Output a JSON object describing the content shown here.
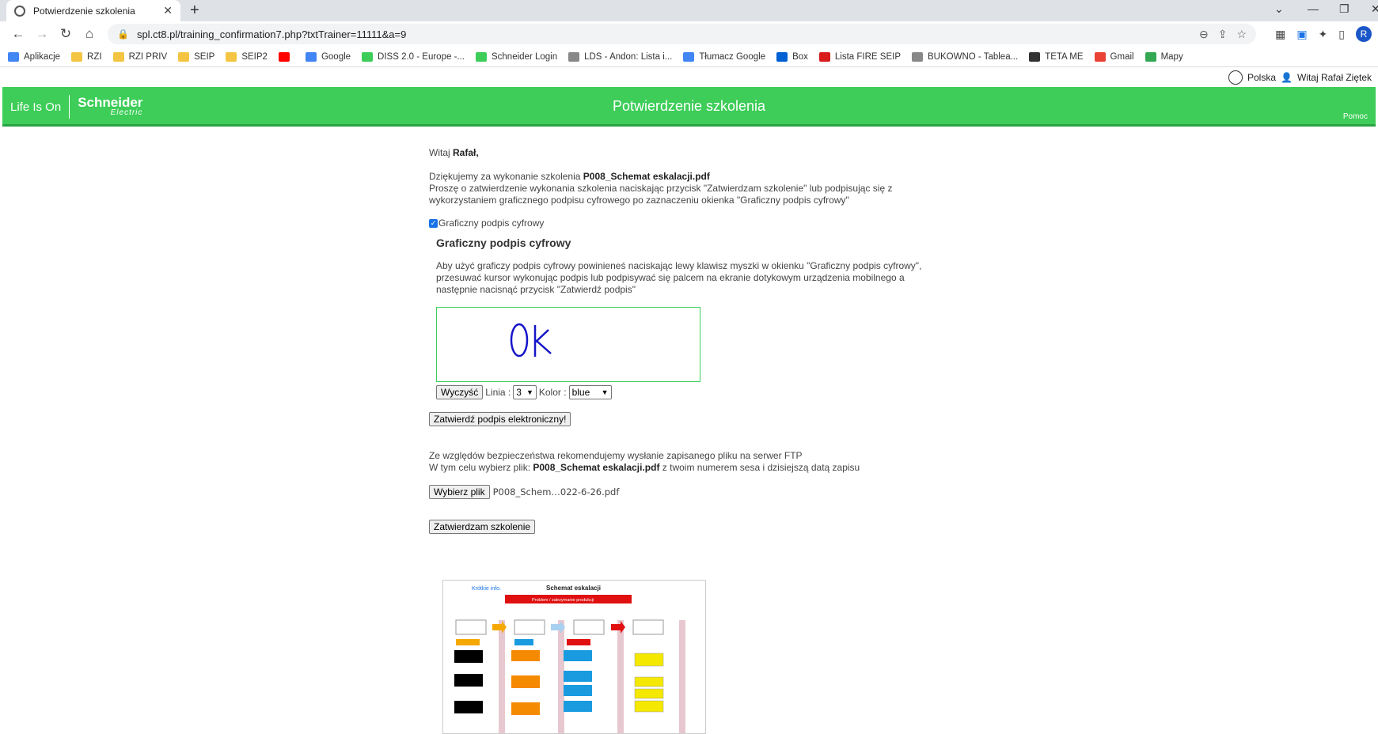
{
  "browser": {
    "tab_title": "Potwierdzenie szkolenia",
    "url": "spl.ct8.pl/training_confirmation7.php?txtTrainer=11111&a=9",
    "profile_initial": "R",
    "bookmarks": [
      {
        "label": "Aplikacje",
        "icon_color": "#4285f4"
      },
      {
        "label": "RZI",
        "icon_color": "#f4c542"
      },
      {
        "label": "RZI PRIV",
        "icon_color": "#f4c542"
      },
      {
        "label": "SEIP",
        "icon_color": "#f4c542"
      },
      {
        "label": "SEIP2",
        "icon_color": "#f4c542"
      },
      {
        "label": "",
        "icon_color": "#ff0000"
      },
      {
        "label": "Google",
        "icon_color": "#4285f4"
      },
      {
        "label": "DISS 2.0 - Europe -...",
        "icon_color": "#3dcd58"
      },
      {
        "label": "Schneider Login",
        "icon_color": "#3dcd58"
      },
      {
        "label": "LDS - Andon: Lista i...",
        "icon_color": "#888888"
      },
      {
        "label": "Tłumacz Google",
        "icon_color": "#4285f4"
      },
      {
        "label": "Box",
        "icon_color": "#0061d5"
      },
      {
        "label": "Lista FIRE SEIP",
        "icon_color": "#d81b1b"
      },
      {
        "label": "BUKOWNO - Tablea...",
        "icon_color": "#888888"
      },
      {
        "label": "TETA ME",
        "icon_color": "#333333"
      },
      {
        "label": "Gmail",
        "icon_color": "#ea4335"
      },
      {
        "label": "Mapy",
        "icon_color": "#34a853"
      }
    ]
  },
  "userbar": {
    "language": "Polska",
    "greeting": "Witaj Rafał Ziętek"
  },
  "header": {
    "life_is_on": "Life Is On",
    "brand": "Schneider",
    "brand_sub": "Electric",
    "title": "Potwierdzenie szkolenia",
    "help": "Pomoc"
  },
  "content": {
    "greeting_prefix": "Witaj ",
    "greeting_name": "Rafał,",
    "thanks_prefix": "Dziękujemy za wykonanie szkolenia ",
    "training_file": "P008_Schemat eskalacji.pdf",
    "instruction": "Proszę o zatwierdzenie wykonania szkolenia naciskając przycisk \"Zatwierdzam szkolenie\" lub podpisując się z wykorzystaniem graficznego podpisu cyfrowego po zaznaczeniu okienka \"Graficzny podpis cyfrowy\"",
    "checkbox_label": "Graficzny podpis cyfrowy",
    "checkbox_checked": true,
    "sig_title": "Graficzny podpis cyfrowy",
    "sig_instruction": "Aby użyć graficzy podpis cyfrowy powinieneś naciskając lewy klawisz myszki w okienku \"Graficzny podpis cyfrowy\", przesuwać kursor wykonując podpis lub podpisywać się palcem na ekranie dotykowym urządzenia mobilnego a następnie nacisnąć przycisk \"Zatwierdź podpis\"",
    "signature_text": "OK",
    "signature_color": "#1515c8",
    "clear_button": "Wyczyść",
    "line_label": "Linia :",
    "line_value": "3",
    "color_label": "Kolor :",
    "color_value": "blue",
    "confirm_signature_button": "Zatwierdź podpis elektroniczny!",
    "ftp_line1": "Ze względów bezpieczeństwa rekomendujemy wysłanie zapisanego pliku na serwer FTP",
    "ftp_line2_prefix": "W tym celu wybierz plik: ",
    "ftp_file": "P008_Schemat eskalacji.pdf",
    "ftp_line2_suffix": " z twoim numerem sesa i dzisiejszą datą zapisu",
    "choose_file_button": "Wybierz plik",
    "chosen_file": "P008_Schem…022-6-26.pdf",
    "confirm_training_button": "Zatwierdzam szkolenie"
  },
  "document_preview": {
    "title": "Schemat eskalacji",
    "banner": "Problem / zatrzymanie produkcji",
    "corner_label": "Krótkie info."
  }
}
